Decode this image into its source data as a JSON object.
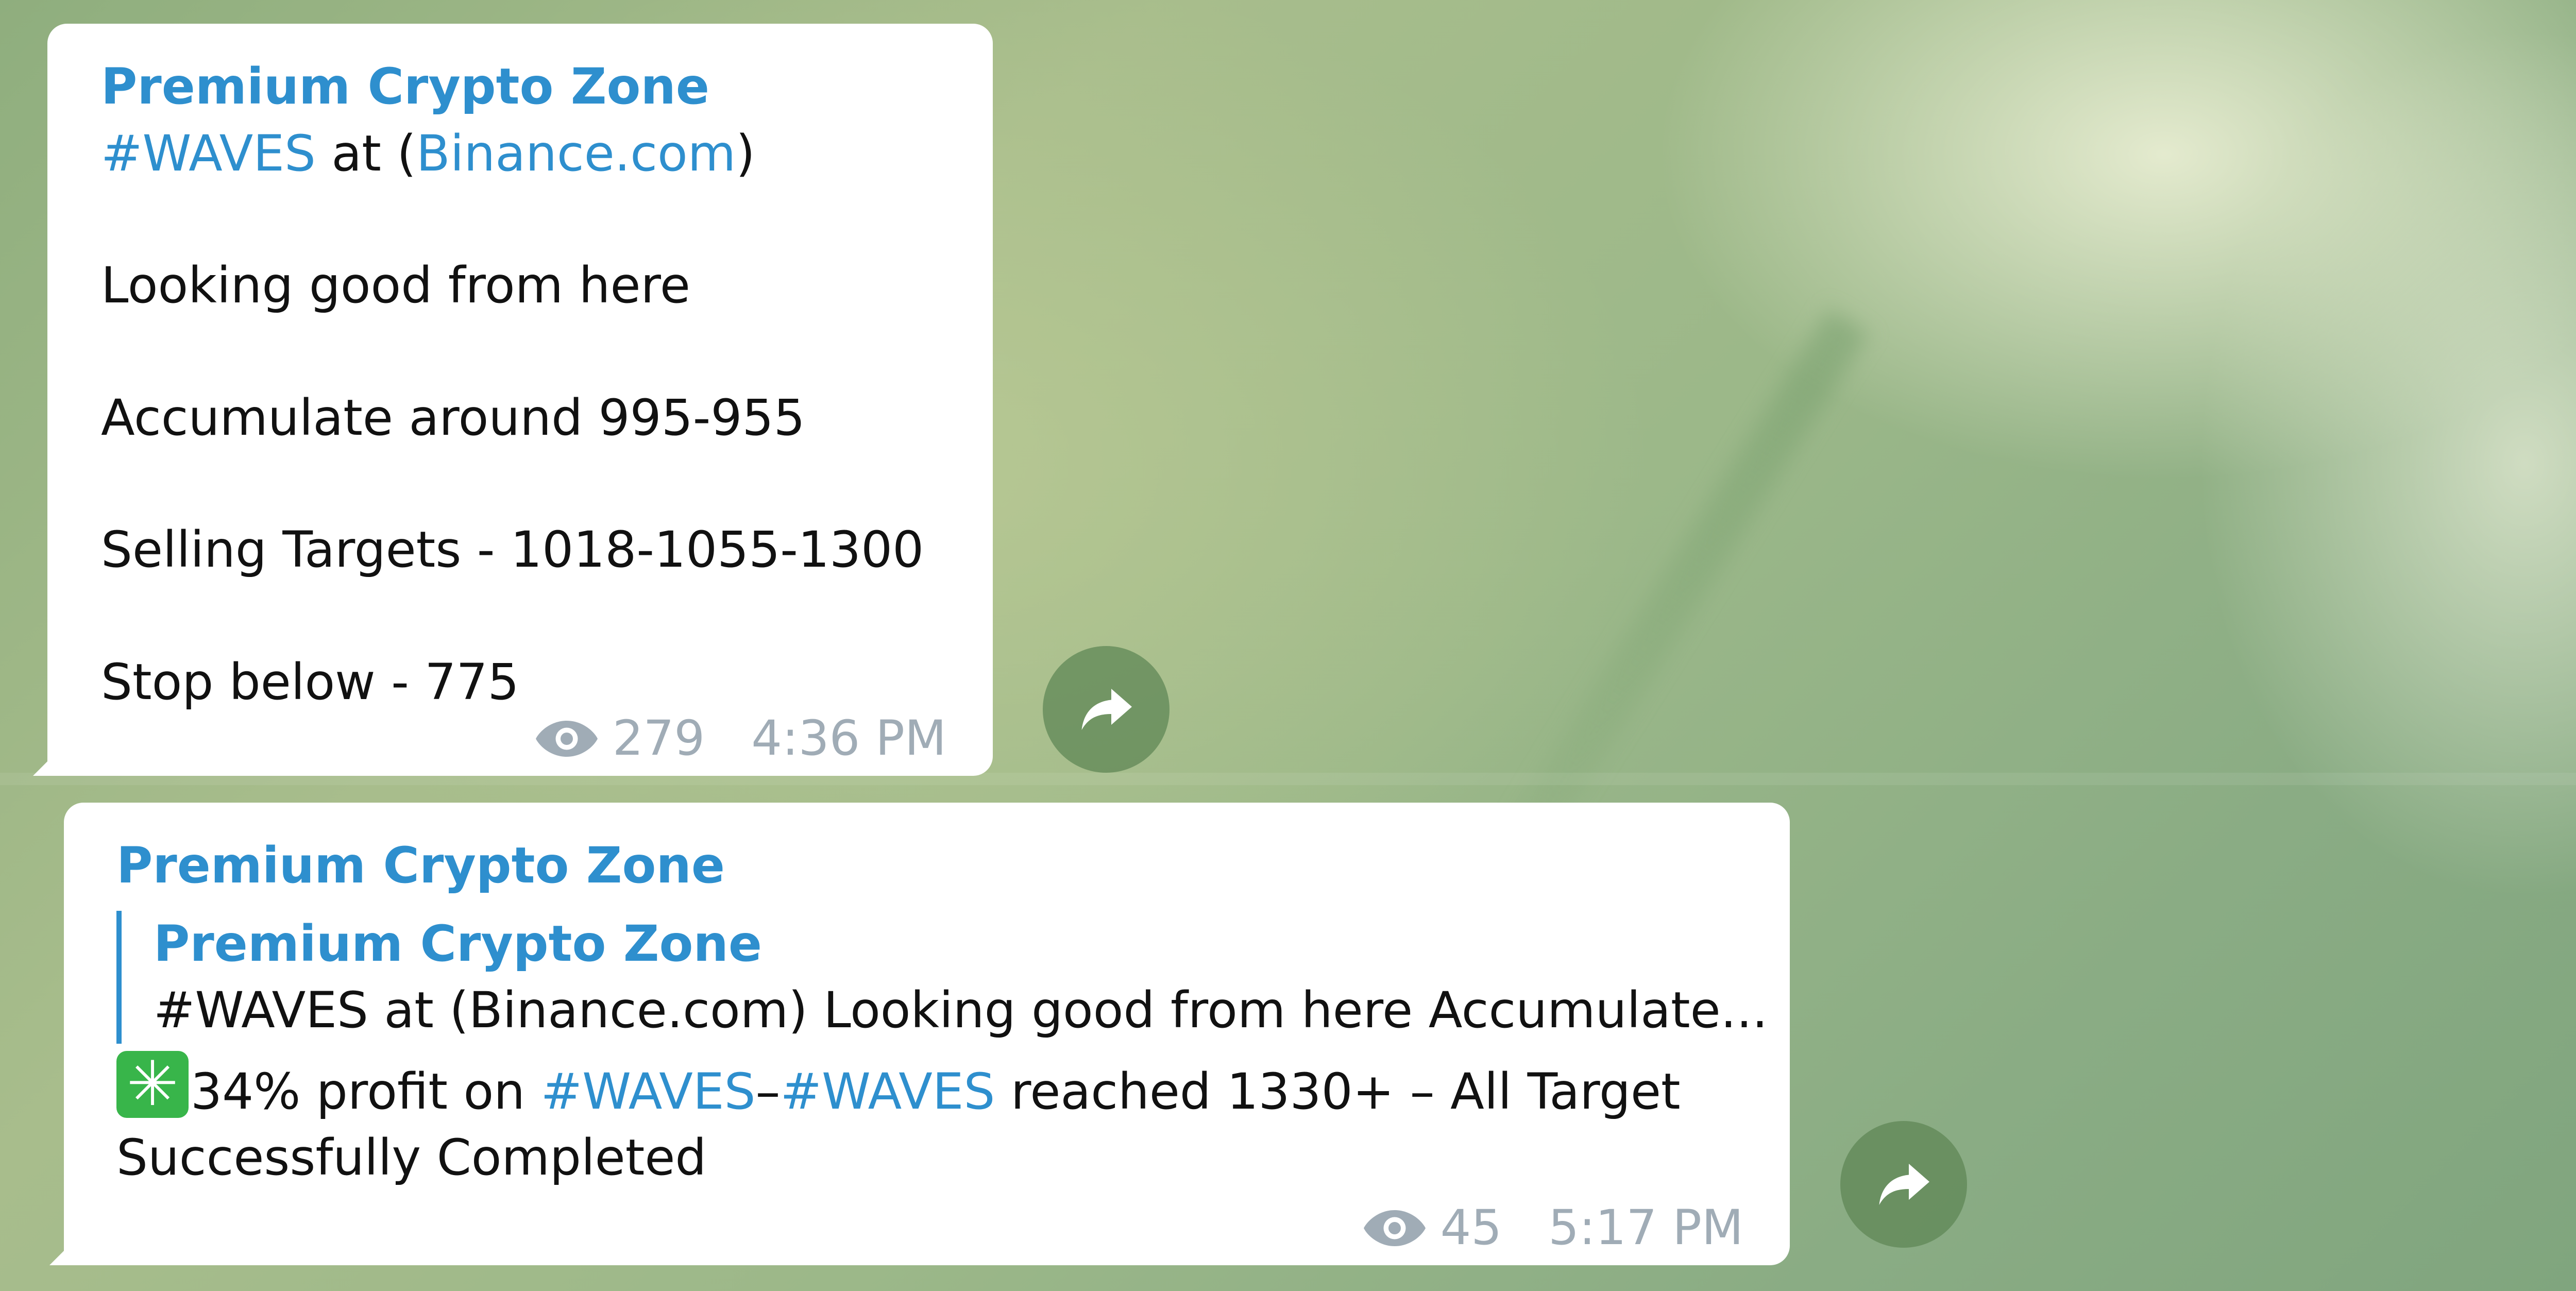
{
  "messages": [
    {
      "author": "Premium Crypto Zone",
      "line1": {
        "tag": "#WAVES",
        "mid": " at (",
        "link": "Binance.com",
        "end": ")"
      },
      "lines": [
        "Looking good from here",
        "Accumulate around 995-955",
        "Selling Targets - 1018-1055-1300",
        "Stop below - 775"
      ],
      "views": "279",
      "time": "4:36 PM"
    },
    {
      "author": "Premium Crypto Zone",
      "reply": {
        "author": "Premium Crypto Zone",
        "snippet": "#WAVES at (Binance.com)  Looking good from here  Accumulate..."
      },
      "text": {
        "sparkle_icon": "✳",
        "part1": "34% profit on ",
        "tag1": "#WAVES",
        "dash": "–",
        "tag2": "#WAVES",
        "part2": " reached 1330+ – All Target",
        "line2": "Successfully Completed"
      },
      "views": "45",
      "time": "5:17 PM"
    }
  ],
  "icons": {
    "views": "eye-icon",
    "share": "share-arrow-icon",
    "emoji": "eight-spoked-asterisk-icon"
  },
  "colors": {
    "link": "#2e8fce",
    "meta": "#a0acb6",
    "bubble": "#ffffff",
    "share_button": "#5f8755"
  }
}
